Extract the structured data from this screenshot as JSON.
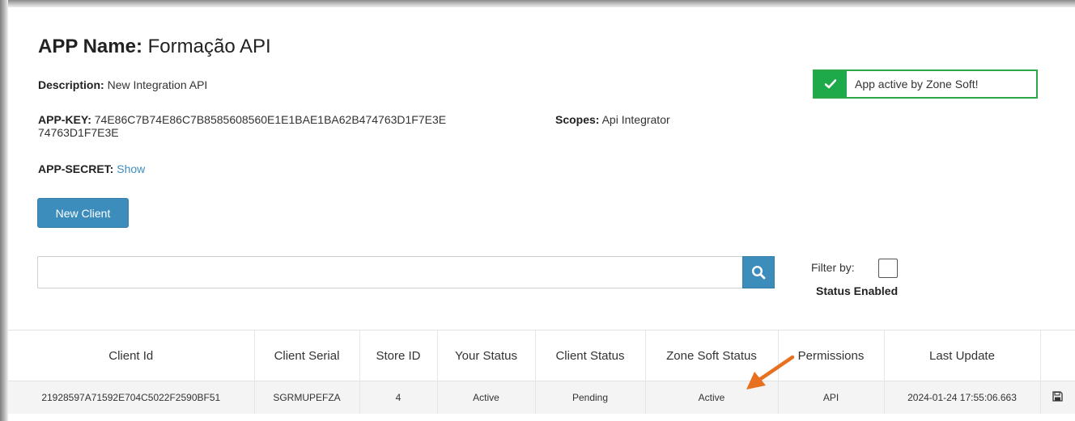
{
  "app": {
    "title_label": "APP Name:",
    "title_value": "Formação API",
    "description_label": "Description:",
    "description_value": "New Integration API",
    "appkey_label": "APP-KEY:",
    "appkey_value_line1": "74E86C7B74E86C7B8585608560E1E1BAE1BA62B474763D1F7E3E",
    "appkey_value_line2": "74763D1F7E3E",
    "scopes_label": "Scopes:",
    "scopes_value": "Api Integrator",
    "secret_label": "APP-SECRET:",
    "secret_link": "Show"
  },
  "status": {
    "text": "App active by Zone Soft!",
    "icon": "check-icon",
    "color": "#1eaa4b"
  },
  "actions": {
    "new_client_label": "New Client"
  },
  "search": {
    "value": "",
    "placeholder": "",
    "icon": "search-icon"
  },
  "filter": {
    "label": "Filter by:",
    "option": "Status Enabled",
    "checked": false
  },
  "table": {
    "headers": [
      "Client Id",
      "Client Serial",
      "Store ID",
      "Your Status",
      "Client Status",
      "Zone Soft Status",
      "Permissions",
      "Last Update",
      ""
    ],
    "rows": [
      {
        "client_id": "21928597A71592E704C5022F2590BF51",
        "client_serial": "SGRMUPEFZA",
        "store_id": "4",
        "your_status": "Active",
        "client_status": "Pending",
        "zone_soft_status": "Active",
        "permissions": "API",
        "last_update": "2024-01-24 17:55:06.663",
        "action_icon": "save-icon"
      }
    ]
  },
  "colors": {
    "accent": "#3c8dbc",
    "success": "#1eaa4b",
    "annotation_arrow": "#e8711f"
  }
}
